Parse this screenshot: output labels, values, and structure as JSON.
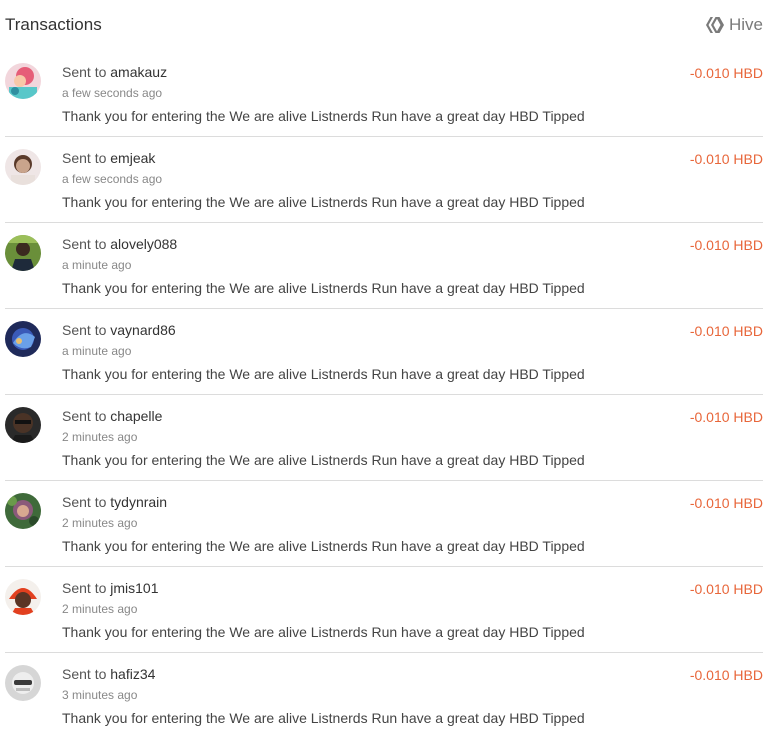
{
  "header": {
    "title": "Transactions",
    "network_label": "Hive",
    "network_icon": "hive-logo-icon"
  },
  "colors": {
    "amount": "#e8663a",
    "divider": "#dcdcdc",
    "hive_gray": "#7a7a7a"
  },
  "transactions": [
    {
      "prefix": "Sent to ",
      "user": "amakauz",
      "time": "a few seconds ago",
      "memo": "Thank you for entering the We are alive Listnerds Run have a great day HBD Tipped",
      "amount": "-0.010 HBD",
      "avatar_icon": "avatar-amakauz-icon"
    },
    {
      "prefix": "Sent to ",
      "user": "emjeak",
      "time": "a few seconds ago",
      "memo": "Thank you for entering the We are alive Listnerds Run have a great day HBD Tipped",
      "amount": "-0.010 HBD",
      "avatar_icon": "avatar-emjeak-icon"
    },
    {
      "prefix": "Sent to ",
      "user": "alovely088",
      "time": "a minute ago",
      "memo": "Thank you for entering the We are alive Listnerds Run have a great day HBD Tipped",
      "amount": "-0.010 HBD",
      "avatar_icon": "avatar-alovely088-icon"
    },
    {
      "prefix": "Sent to ",
      "user": "vaynard86",
      "time": "a minute ago",
      "memo": "Thank you for entering the We are alive Listnerds Run have a great day HBD Tipped",
      "amount": "-0.010 HBD",
      "avatar_icon": "avatar-vaynard86-icon"
    },
    {
      "prefix": "Sent to ",
      "user": "chapelle",
      "time": "2 minutes ago",
      "memo": "Thank you for entering the We are alive Listnerds Run have a great day HBD Tipped",
      "amount": "-0.010 HBD",
      "avatar_icon": "avatar-chapelle-icon"
    },
    {
      "prefix": "Sent to ",
      "user": "tydynrain",
      "time": "2 minutes ago",
      "memo": "Thank you for entering the We are alive Listnerds Run have a great day HBD Tipped",
      "amount": "-0.010 HBD",
      "avatar_icon": "avatar-tydynrain-icon"
    },
    {
      "prefix": "Sent to ",
      "user": "jmis101",
      "time": "2 minutes ago",
      "memo": "Thank you for entering the We are alive Listnerds Run have a great day HBD Tipped",
      "amount": "-0.010 HBD",
      "avatar_icon": "avatar-jmis101-icon"
    },
    {
      "prefix": "Sent to ",
      "user": "hafiz34",
      "time": "3 minutes ago",
      "memo": "Thank you for entering the We are alive Listnerds Run have a great day HBD Tipped",
      "amount": "-0.010 HBD",
      "avatar_icon": "avatar-hafiz34-icon"
    }
  ]
}
